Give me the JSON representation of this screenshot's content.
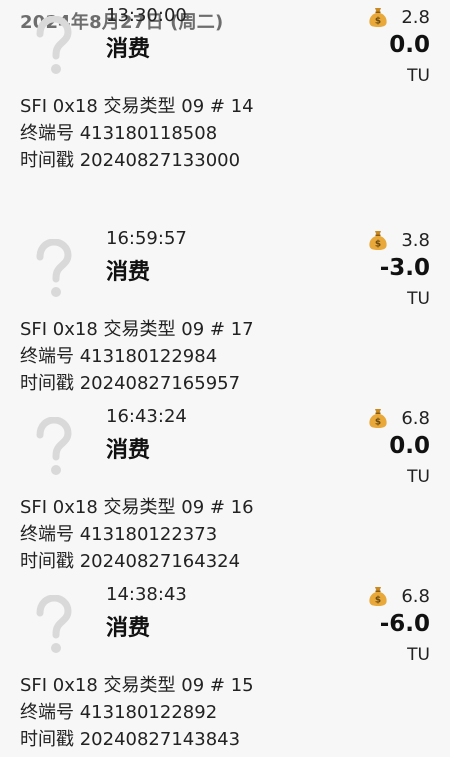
{
  "date_header": "2024年8月27日 (周二)",
  "transactions": [
    {
      "time": "16:59:57",
      "type": "消费",
      "balance": "3.8",
      "amount": "-3.0",
      "unit": "TU",
      "line1": "SFI 0x18  交易类型 09  # 17",
      "line2": "终端号 413180122984",
      "line3": "时间戳 20240827165957"
    },
    {
      "time": "16:43:24",
      "type": "消费",
      "balance": "6.8",
      "amount": "0.0",
      "unit": "TU",
      "line1": "SFI 0x18  交易类型 09  # 16",
      "line2": "终端号 413180122373",
      "line3": "时间戳 20240827164324"
    },
    {
      "time": "14:38:43",
      "type": "消费",
      "balance": "6.8",
      "amount": "-6.0",
      "unit": "TU",
      "line1": "SFI 0x18  交易类型 09  # 15",
      "line2": "终端号 413180122892",
      "line3": "时间戳 20240827143843"
    },
    {
      "time": "13:30:00",
      "type": "消费",
      "balance": "2.8",
      "amount": "0.0",
      "unit": "TU",
      "line1": "SFI 0x18  交易类型 09  # 14",
      "line2": "终端号 413180118508",
      "line3": "时间戳 20240827133000"
    }
  ],
  "icons": {
    "transaction_icon": "question-mark-icon",
    "balance_icon": "money-bag-icon"
  },
  "colors": {
    "background": "#f7f7f7",
    "question_mark": "#d9d9d9",
    "money_bag": "#e8a93a"
  }
}
